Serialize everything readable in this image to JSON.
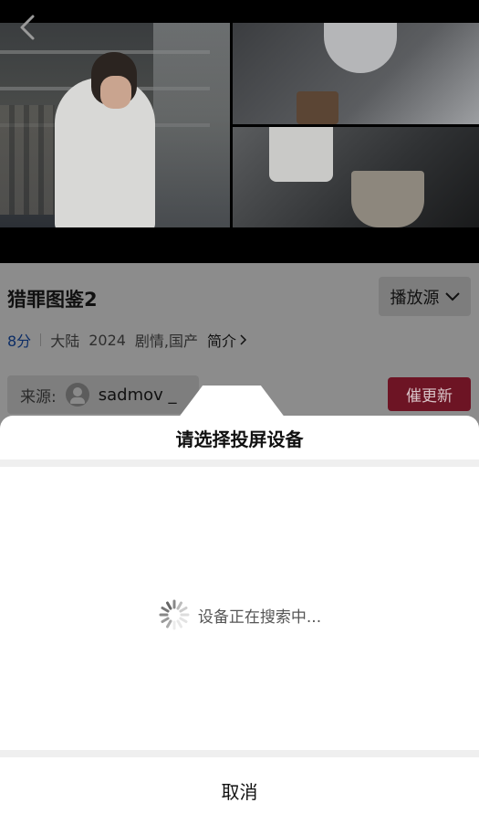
{
  "video": {
    "back_icon": "chevron-left-icon"
  },
  "drama": {
    "title": "猎罪图鉴2",
    "source_button_label": "播放源",
    "score": "8分",
    "region": "大陆",
    "year": "2024",
    "genres": "剧情,国产",
    "intro_label": "简介",
    "source_label": "来源:",
    "source_user": "sadmov _",
    "update_button_label": "催更新"
  },
  "cast_sheet": {
    "title": "请选择投屏设备",
    "status_text": "设备正在搜索中...",
    "cancel_label": "取消"
  },
  "colors": {
    "accent_red": "#c0263f",
    "score_blue": "#2f65c8"
  }
}
